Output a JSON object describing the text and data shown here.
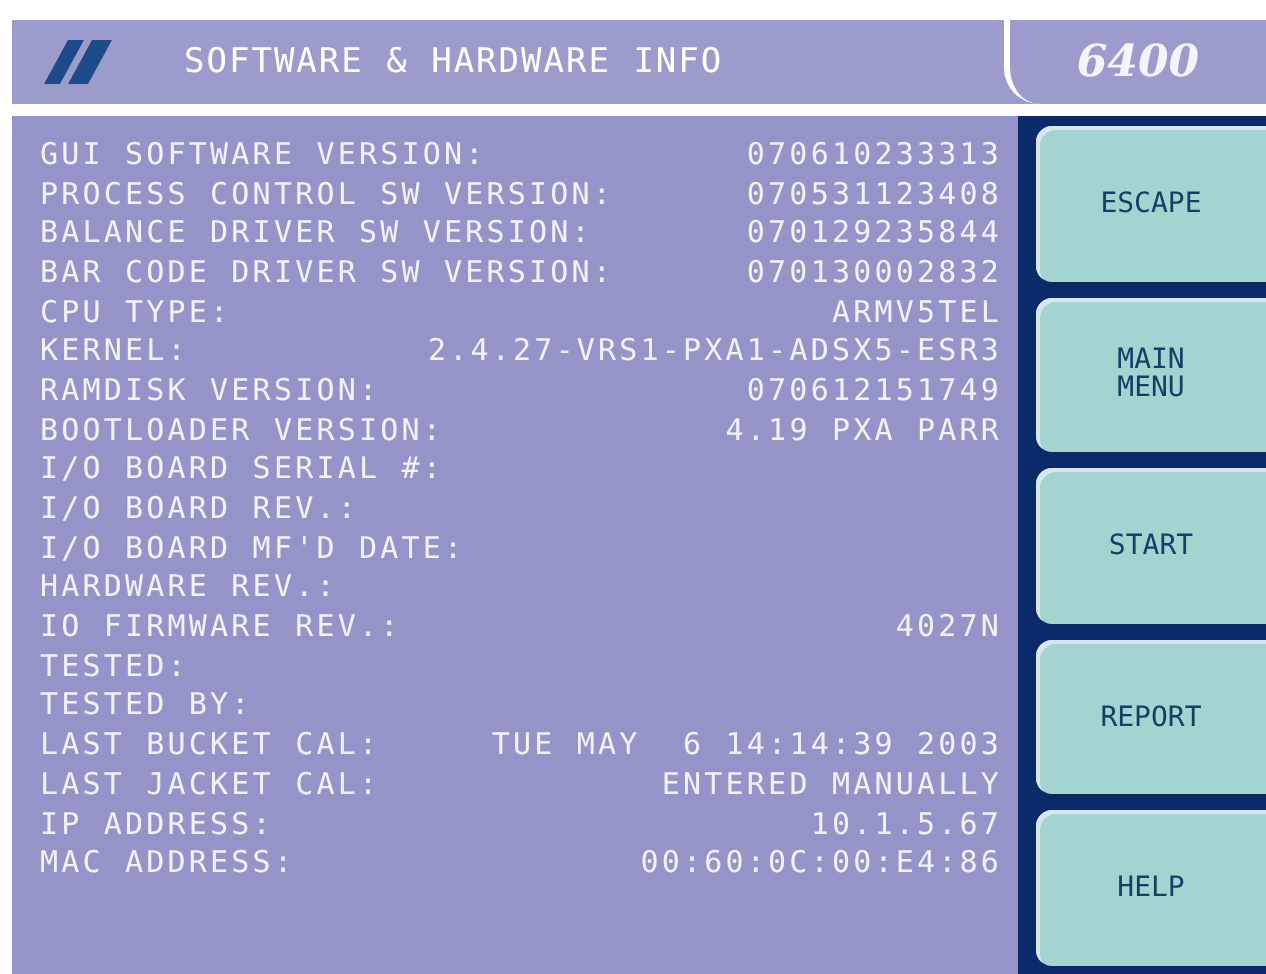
{
  "header": {
    "title": "SOFTWARE & HARDWARE INFO",
    "model": "6400"
  },
  "rows": [
    {
      "label": "GUI SOFTWARE VERSION:",
      "value": "070610233313"
    },
    {
      "label": "PROCESS CONTROL SW VERSION:",
      "value": "070531123408"
    },
    {
      "label": "BALANCE DRIVER SW VERSION:",
      "value": "070129235844"
    },
    {
      "label": "BAR CODE DRIVER SW VERSION:",
      "value": "070130002832"
    },
    {
      "label": "CPU TYPE:",
      "value": "ARMV5TEL"
    },
    {
      "label": "KERNEL:",
      "value": "2.4.27-VRS1-PXA1-ADSX5-ESR3"
    },
    {
      "label": "RAMDISK VERSION:",
      "value": "070612151749"
    },
    {
      "label": "BOOTLOADER VERSION:",
      "value": "4.19 PXA PARR"
    },
    {
      "label": "I/O BOARD SERIAL #:"
    },
    {
      "label": "I/O BOARD REV.:"
    },
    {
      "label": "I/O BOARD MF'D DATE:"
    },
    {
      "label": "HARDWARE REV.:"
    },
    {
      "label": "IO FIRMWARE REV.:",
      "value": "4027N"
    },
    {
      "label": "TESTED:"
    },
    {
      "label": "TESTED BY:"
    },
    {
      "label": "LAST BUCKET CAL:",
      "value": "TUE MAY  6 14:14:39 2003"
    },
    {
      "label": "LAST JACKET CAL:",
      "value": "ENTERED MANUALLY"
    },
    {
      "label": "IP ADDRESS:",
      "value": "10.1.5.67"
    },
    {
      "label": "MAC ADDRESS:",
      "value": "00:60:0C:00:E4:86"
    }
  ],
  "buttons": [
    {
      "label": "ESCAPE"
    },
    {
      "label": "MAIN\nMENU"
    },
    {
      "label": "START"
    },
    {
      "label": "REPORT"
    },
    {
      "label": "HELP"
    }
  ]
}
